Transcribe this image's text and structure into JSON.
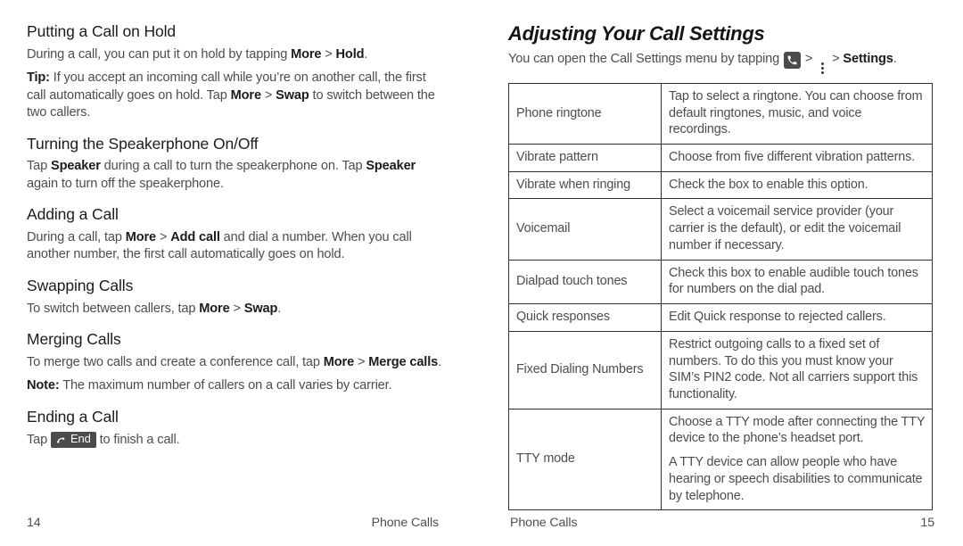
{
  "left_page": {
    "sections": [
      {
        "heading": "Putting a Call on Hold",
        "paragraphs": [
          {
            "id": "p1",
            "parts": [
              "During a call, you can put it on hold by tapping ",
              "More",
              " > ",
              "Hold",
              "."
            ]
          },
          {
            "id": "p2",
            "parts": [
              "Tip:",
              " If you accept an incoming call while you’re on another call, the first call automatically goes on hold. Tap ",
              "More",
              " > ",
              "Swap",
              " to switch between the two callers."
            ]
          }
        ]
      },
      {
        "heading": "Turning the Speakerphone On/Off",
        "paragraphs": [
          {
            "id": "p3",
            "parts": [
              "Tap ",
              "Speaker",
              " during a call to turn the speakerphone on. Tap ",
              "Speaker",
              " again to turn off the speakerphone."
            ]
          }
        ]
      },
      {
        "heading": "Adding a Call",
        "paragraphs": [
          {
            "id": "p4",
            "parts": [
              "During a call, tap ",
              "More",
              " > ",
              "Add call",
              " and dial a number. When you call another number, the first call automatically goes on hold."
            ]
          }
        ]
      },
      {
        "heading": "Swapping Calls",
        "paragraphs": [
          {
            "id": "p5",
            "parts": [
              "To switch between callers, tap ",
              "More",
              " > ",
              "Swap",
              "."
            ]
          }
        ]
      },
      {
        "heading": "Merging Calls",
        "paragraphs": [
          {
            "id": "p6",
            "parts": [
              "To merge two calls and create a conference call, tap ",
              "More",
              " > ",
              "Merge calls",
              "."
            ]
          },
          {
            "id": "p7",
            "parts": [
              "Note:",
              " The maximum number of callers on a call varies by carrier."
            ]
          }
        ]
      },
      {
        "heading": "Ending a Call",
        "paragraphs": [
          {
            "id": "p8",
            "parts": [
              "Tap ",
              "End",
              " to finish a call."
            ]
          }
        ]
      }
    ],
    "text": {
      "s1_heading": "Putting a Call on Hold",
      "s1_p1_a": "During a call, you can put it on hold by tapping ",
      "s1_p1_more": "More",
      "s1_p1_gt": " > ",
      "s1_p1_hold": "Hold",
      "s1_p1_end": ".",
      "s1_p2_tip": "Tip:",
      "s1_p2_a": " If you accept an incoming call while you’re on another call, the first call automatically goes on hold. Tap ",
      "s1_p2_more": "More",
      "s1_p2_gt": " > ",
      "s1_p2_swap": "Swap",
      "s1_p2_end": " to switch between the two callers.",
      "s2_heading": "Turning the Speakerphone On/Off",
      "s2_p1_a": "Tap ",
      "s2_p1_speaker1": "Speaker",
      "s2_p1_b": " during a call to turn the speakerphone on. Tap ",
      "s2_p1_speaker2": "Speaker",
      "s2_p1_c": " again to turn off the speakerphone.",
      "s3_heading": "Adding a Call",
      "s3_p1_a": "During a call, tap ",
      "s3_p1_more": "More",
      "s3_p1_gt": " > ",
      "s3_p1_addcall": "Add call",
      "s3_p1_b": " and dial a number. When you call another number, the first call automatically goes on hold.",
      "s4_heading": "Swapping Calls",
      "s4_p1_a": "To switch between callers, tap ",
      "s4_p1_more": "More",
      "s4_p1_gt": " > ",
      "s4_p1_swap": "Swap",
      "s4_p1_end": ".",
      "s5_heading": "Merging Calls",
      "s5_p1_a": "To merge two calls and create a conference call, tap ",
      "s5_p1_more": "More",
      "s5_p1_gt": " > ",
      "s5_p1_merge": "Merge calls",
      "s5_p1_end": ".",
      "s5_p2_note": "Note:",
      "s5_p2_a": " The maximum number of callers on a call varies by carrier.",
      "s6_heading": "Ending a Call",
      "s6_p1_a": "Tap ",
      "s6_p1_btn": "End",
      "s6_p1_b": " to finish a call."
    },
    "footer": {
      "page_number": "14",
      "chapter_label": "Phone Calls"
    }
  },
  "right_page": {
    "heading": "Adjusting Your Call Settings",
    "intro": {
      "a": "You can open the Call Settings menu by tapping ",
      "gt1": " > ",
      "gt2": " > ",
      "settings": "Settings",
      "end": "."
    },
    "icons": {
      "phone": "phone-icon",
      "overflow_menu": "vertical-dots-icon"
    },
    "table": {
      "rows": [
        {
          "setting": "Phone ringtone",
          "description": [
            "Tap to select a ringtone. You can choose from default ringtones, music, and voice recordings."
          ]
        },
        {
          "setting": "Vibrate pattern",
          "description": [
            "Choose from five different vibration patterns."
          ]
        },
        {
          "setting": "Vibrate when ringing",
          "description": [
            "Check the box to enable this option."
          ]
        },
        {
          "setting": "Voicemail",
          "description": [
            "Select a voicemail service provider (your carrier is the default), or edit the voicemail number if necessary."
          ]
        },
        {
          "setting": "Dialpad touch tones",
          "description": [
            "Check this box to enable audible touch tones for numbers on the dial pad."
          ]
        },
        {
          "setting": "Quick responses",
          "description": [
            "Edit Quick response to rejected callers."
          ]
        },
        {
          "setting": "Fixed Dialing Numbers",
          "description": [
            "Restrict outgoing calls to a fixed set of numbers. To do this you must know your SIM’s PIN2 code. Not all carriers support this functionality."
          ]
        },
        {
          "setting": "TTY mode",
          "description": [
            "Choose a TTY mode after connecting the TTY device to the phone’s headset port.",
            "A TTY device can allow people who have hearing or speech disabilities to communicate by telephone."
          ]
        }
      ]
    },
    "footer": {
      "chapter_label": "Phone Calls",
      "page_number": "15"
    }
  },
  "colors": {
    "heading": "#1c1c1c",
    "body": "#4d4d4d",
    "table_border": "#2f2f2f",
    "icon_dark": "#4b4b4b",
    "page_background": "#ffffff"
  }
}
